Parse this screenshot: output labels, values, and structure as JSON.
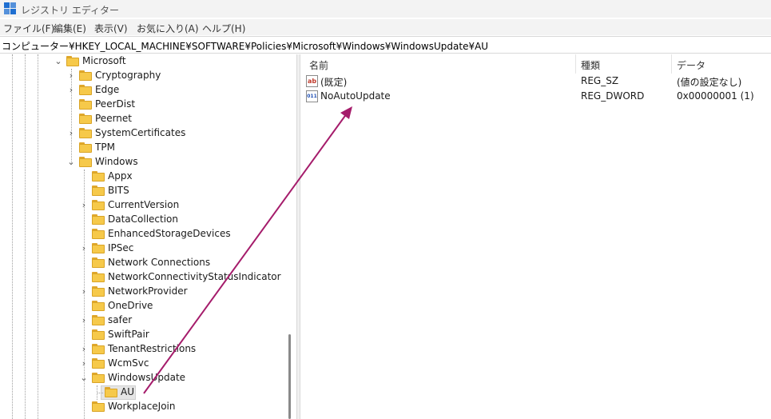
{
  "window": {
    "title": "レジストリ エディター",
    "icon": "registry-editor-icon"
  },
  "menu": [
    "ファイル(F)",
    "編集(E)",
    "表示(V)",
    "お気に入り(A)",
    "ヘルプ(H)"
  ],
  "address": "コンピューター¥HKEY_LOCAL_MACHINE¥SOFTWARE¥Policies¥Microsoft¥Windows¥WindowsUpdate¥AU",
  "tree": {
    "microsoft": "Microsoft",
    "level2": [
      "Cryptography",
      "Edge",
      "PeerDist",
      "Peernet",
      "SystemCertificates",
      "TPM",
      "Windows"
    ],
    "windows_children": [
      "Appx",
      "BITS",
      "CurrentVersion",
      "DataCollection",
      "EnhancedStorageDevices",
      "IPSec",
      "Network Connections",
      "NetworkConnectivityStatusIndicator",
      "NetworkProvider",
      "OneDrive",
      "safer",
      "SwiftPair",
      "TenantRestrictions",
      "WcmSvc",
      "WindowsUpdate",
      "AU",
      "WorkplaceJoin"
    ],
    "selected": "AU"
  },
  "list": {
    "columns": [
      "名前",
      "種類",
      "データ"
    ],
    "rows": [
      {
        "icon": "string-value-icon",
        "icon_text": "ab",
        "name": "(既定)",
        "type": "REG_SZ",
        "data": "(値の設定なし)"
      },
      {
        "icon": "dword-value-icon",
        "icon_text": "011",
        "name": "NoAutoUpdate",
        "type": "REG_DWORD",
        "data": "0x00000001 (1)"
      }
    ]
  },
  "colors": {
    "accent": "#1f6fd1",
    "arrow": "#a51c6b",
    "folder": "#f6c94a"
  }
}
